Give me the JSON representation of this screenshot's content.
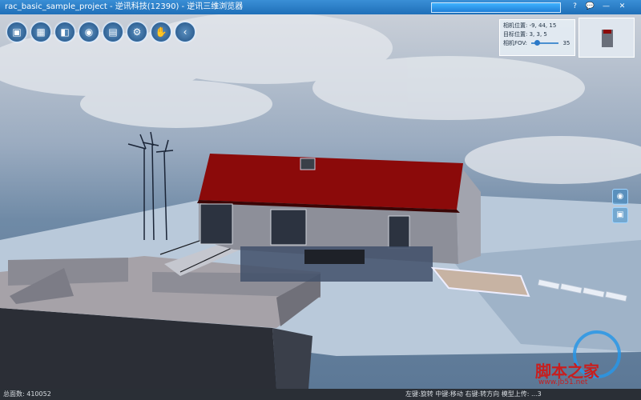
{
  "window": {
    "title": "rac_basic_sample_project - 逆讯科技(12390) - 逆讯三维浏览器",
    "help_icon": "?",
    "chat_icon": "💬",
    "minimize": "—",
    "close": "✕"
  },
  "toolbar": {
    "icons": [
      "save-icon",
      "capture-icon",
      "layers-icon",
      "view-icon",
      "screen-icon",
      "settings-icon",
      "measure-icon",
      "back-icon"
    ],
    "glyphs": [
      "▣",
      "▦",
      "◧",
      "◉",
      "▤",
      "⚙",
      "✋",
      "‹"
    ]
  },
  "camera": {
    "position_label": "相机位置:",
    "position_value": "-9, 44, 15",
    "target_label": "目标位置:",
    "target_value": "3, 3, 5",
    "fov_label": "相机FOV:",
    "fov_value": "35"
  },
  "side_buttons": {
    "top": "◉",
    "bottom": "▣"
  },
  "status": {
    "face_count_label": "总面数:",
    "face_count": "410052",
    "controls": "左键:旋转 中键:移动 右键:转方向   模型上传:  ...3"
  },
  "watermark": {
    "text": "脚本之家",
    "url": "www.jb51.net"
  },
  "colors": {
    "titlebar": "#2a7fcc",
    "roof": "#8b0a0a",
    "walls": "#8d8f99",
    "terrain": "#b9c9da",
    "status_bg": "#2a2f36"
  }
}
